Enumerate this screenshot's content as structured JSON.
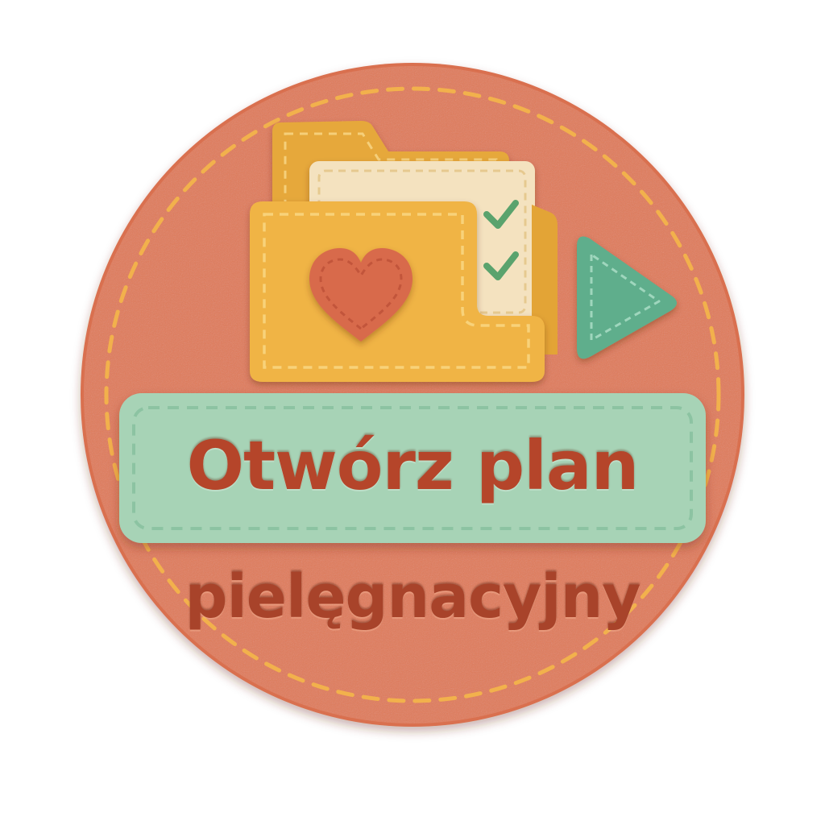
{
  "badge": {
    "primary_label": "Otwórz plan",
    "secondary_label": "pielęgnacyjny",
    "icons": {
      "folder": "folder-icon",
      "heart": "heart-icon",
      "checklist": "checklist-icon",
      "play": "play-icon"
    },
    "colors": {
      "badge_fill": "#e07a58",
      "stitch": "#f0b04a",
      "button_fill": "#a7d3b6",
      "text": "#b5452a",
      "folder": "#efb645",
      "play": "#5fae8c"
    }
  }
}
